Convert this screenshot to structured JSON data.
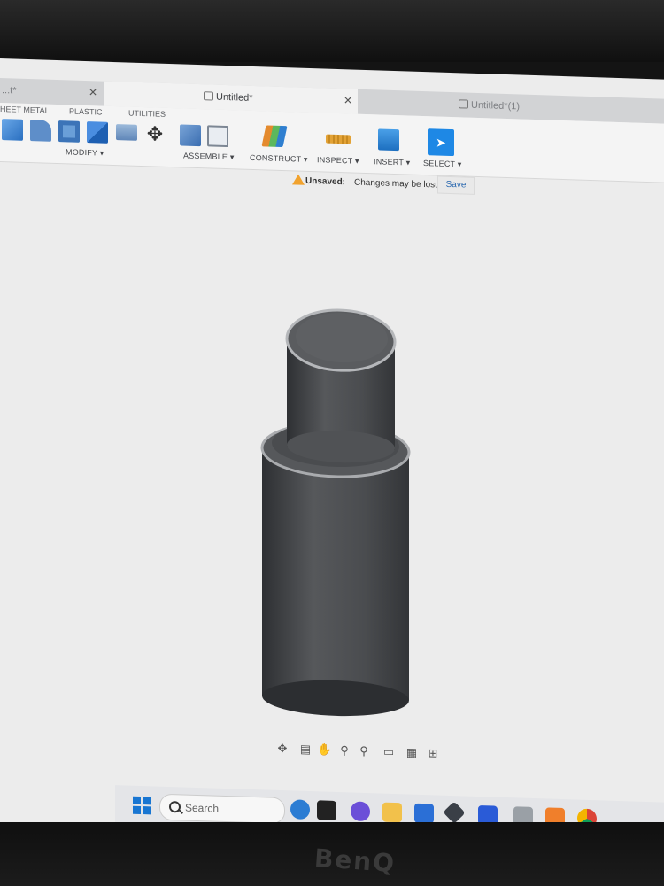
{
  "tabs": [
    {
      "label": "...t*",
      "close": "✕"
    },
    {
      "label": "Untitled*",
      "close": "✕"
    },
    {
      "label": "Untitled*(1)",
      "close": ""
    }
  ],
  "ribbon": {
    "sections": [
      "HEET METAL",
      "PLASTIC",
      "UTILITIES"
    ],
    "groups": [
      "MODIFY ▾",
      "ASSEMBLE ▾",
      "CONSTRUCT ▾",
      "INSPECT ▾",
      "INSERT ▾",
      "SELECT ▾"
    ]
  },
  "notice": {
    "status": "Unsaved:",
    "message": "Changes may be lost",
    "save": "Save"
  },
  "taskbar": {
    "search_placeholder": "Search"
  },
  "colors": {
    "accent": "#2d6ab0",
    "select_blue": "#1e88e5",
    "model_body": "#4f5154",
    "warning": "#f1a22d"
  },
  "icons": [
    "push-pull-icon",
    "fillet-icon",
    "shell-icon",
    "combine-icon",
    "move-icon",
    "new-component-icon",
    "joint-icon",
    "plane-icon",
    "measure-icon",
    "insert-image-icon",
    "select-cursor-icon",
    "orbit-icon",
    "look-at-icon",
    "pan-hand-icon",
    "zoom-icon",
    "zoom-window-icon",
    "display-settings-icon",
    "grid-icon",
    "viewports-icon"
  ]
}
